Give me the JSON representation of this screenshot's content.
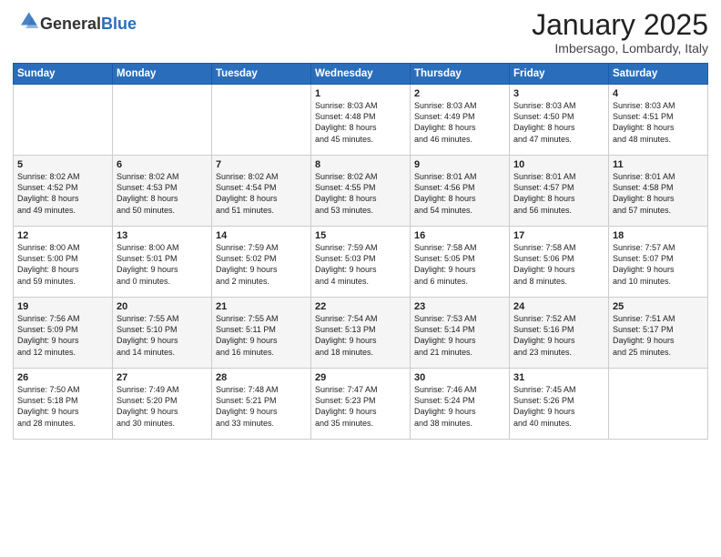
{
  "header": {
    "logo_line1": "General",
    "logo_line2": "Blue",
    "month": "January 2025",
    "location": "Imbersago, Lombardy, Italy"
  },
  "weekdays": [
    "Sunday",
    "Monday",
    "Tuesday",
    "Wednesday",
    "Thursday",
    "Friday",
    "Saturday"
  ],
  "weeks": [
    [
      {
        "day": "",
        "info": ""
      },
      {
        "day": "",
        "info": ""
      },
      {
        "day": "",
        "info": ""
      },
      {
        "day": "1",
        "info": "Sunrise: 8:03 AM\nSunset: 4:48 PM\nDaylight: 8 hours\nand 45 minutes."
      },
      {
        "day": "2",
        "info": "Sunrise: 8:03 AM\nSunset: 4:49 PM\nDaylight: 8 hours\nand 46 minutes."
      },
      {
        "day": "3",
        "info": "Sunrise: 8:03 AM\nSunset: 4:50 PM\nDaylight: 8 hours\nand 47 minutes."
      },
      {
        "day": "4",
        "info": "Sunrise: 8:03 AM\nSunset: 4:51 PM\nDaylight: 8 hours\nand 48 minutes."
      }
    ],
    [
      {
        "day": "5",
        "info": "Sunrise: 8:02 AM\nSunset: 4:52 PM\nDaylight: 8 hours\nand 49 minutes."
      },
      {
        "day": "6",
        "info": "Sunrise: 8:02 AM\nSunset: 4:53 PM\nDaylight: 8 hours\nand 50 minutes."
      },
      {
        "day": "7",
        "info": "Sunrise: 8:02 AM\nSunset: 4:54 PM\nDaylight: 8 hours\nand 51 minutes."
      },
      {
        "day": "8",
        "info": "Sunrise: 8:02 AM\nSunset: 4:55 PM\nDaylight: 8 hours\nand 53 minutes."
      },
      {
        "day": "9",
        "info": "Sunrise: 8:01 AM\nSunset: 4:56 PM\nDaylight: 8 hours\nand 54 minutes."
      },
      {
        "day": "10",
        "info": "Sunrise: 8:01 AM\nSunset: 4:57 PM\nDaylight: 8 hours\nand 56 minutes."
      },
      {
        "day": "11",
        "info": "Sunrise: 8:01 AM\nSunset: 4:58 PM\nDaylight: 8 hours\nand 57 minutes."
      }
    ],
    [
      {
        "day": "12",
        "info": "Sunrise: 8:00 AM\nSunset: 5:00 PM\nDaylight: 8 hours\nand 59 minutes."
      },
      {
        "day": "13",
        "info": "Sunrise: 8:00 AM\nSunset: 5:01 PM\nDaylight: 9 hours\nand 0 minutes."
      },
      {
        "day": "14",
        "info": "Sunrise: 7:59 AM\nSunset: 5:02 PM\nDaylight: 9 hours\nand 2 minutes."
      },
      {
        "day": "15",
        "info": "Sunrise: 7:59 AM\nSunset: 5:03 PM\nDaylight: 9 hours\nand 4 minutes."
      },
      {
        "day": "16",
        "info": "Sunrise: 7:58 AM\nSunset: 5:05 PM\nDaylight: 9 hours\nand 6 minutes."
      },
      {
        "day": "17",
        "info": "Sunrise: 7:58 AM\nSunset: 5:06 PM\nDaylight: 9 hours\nand 8 minutes."
      },
      {
        "day": "18",
        "info": "Sunrise: 7:57 AM\nSunset: 5:07 PM\nDaylight: 9 hours\nand 10 minutes."
      }
    ],
    [
      {
        "day": "19",
        "info": "Sunrise: 7:56 AM\nSunset: 5:09 PM\nDaylight: 9 hours\nand 12 minutes."
      },
      {
        "day": "20",
        "info": "Sunrise: 7:55 AM\nSunset: 5:10 PM\nDaylight: 9 hours\nand 14 minutes."
      },
      {
        "day": "21",
        "info": "Sunrise: 7:55 AM\nSunset: 5:11 PM\nDaylight: 9 hours\nand 16 minutes."
      },
      {
        "day": "22",
        "info": "Sunrise: 7:54 AM\nSunset: 5:13 PM\nDaylight: 9 hours\nand 18 minutes."
      },
      {
        "day": "23",
        "info": "Sunrise: 7:53 AM\nSunset: 5:14 PM\nDaylight: 9 hours\nand 21 minutes."
      },
      {
        "day": "24",
        "info": "Sunrise: 7:52 AM\nSunset: 5:16 PM\nDaylight: 9 hours\nand 23 minutes."
      },
      {
        "day": "25",
        "info": "Sunrise: 7:51 AM\nSunset: 5:17 PM\nDaylight: 9 hours\nand 25 minutes."
      }
    ],
    [
      {
        "day": "26",
        "info": "Sunrise: 7:50 AM\nSunset: 5:18 PM\nDaylight: 9 hours\nand 28 minutes."
      },
      {
        "day": "27",
        "info": "Sunrise: 7:49 AM\nSunset: 5:20 PM\nDaylight: 9 hours\nand 30 minutes."
      },
      {
        "day": "28",
        "info": "Sunrise: 7:48 AM\nSunset: 5:21 PM\nDaylight: 9 hours\nand 33 minutes."
      },
      {
        "day": "29",
        "info": "Sunrise: 7:47 AM\nSunset: 5:23 PM\nDaylight: 9 hours\nand 35 minutes."
      },
      {
        "day": "30",
        "info": "Sunrise: 7:46 AM\nSunset: 5:24 PM\nDaylight: 9 hours\nand 38 minutes."
      },
      {
        "day": "31",
        "info": "Sunrise: 7:45 AM\nSunset: 5:26 PM\nDaylight: 9 hours\nand 40 minutes."
      },
      {
        "day": "",
        "info": ""
      }
    ]
  ]
}
